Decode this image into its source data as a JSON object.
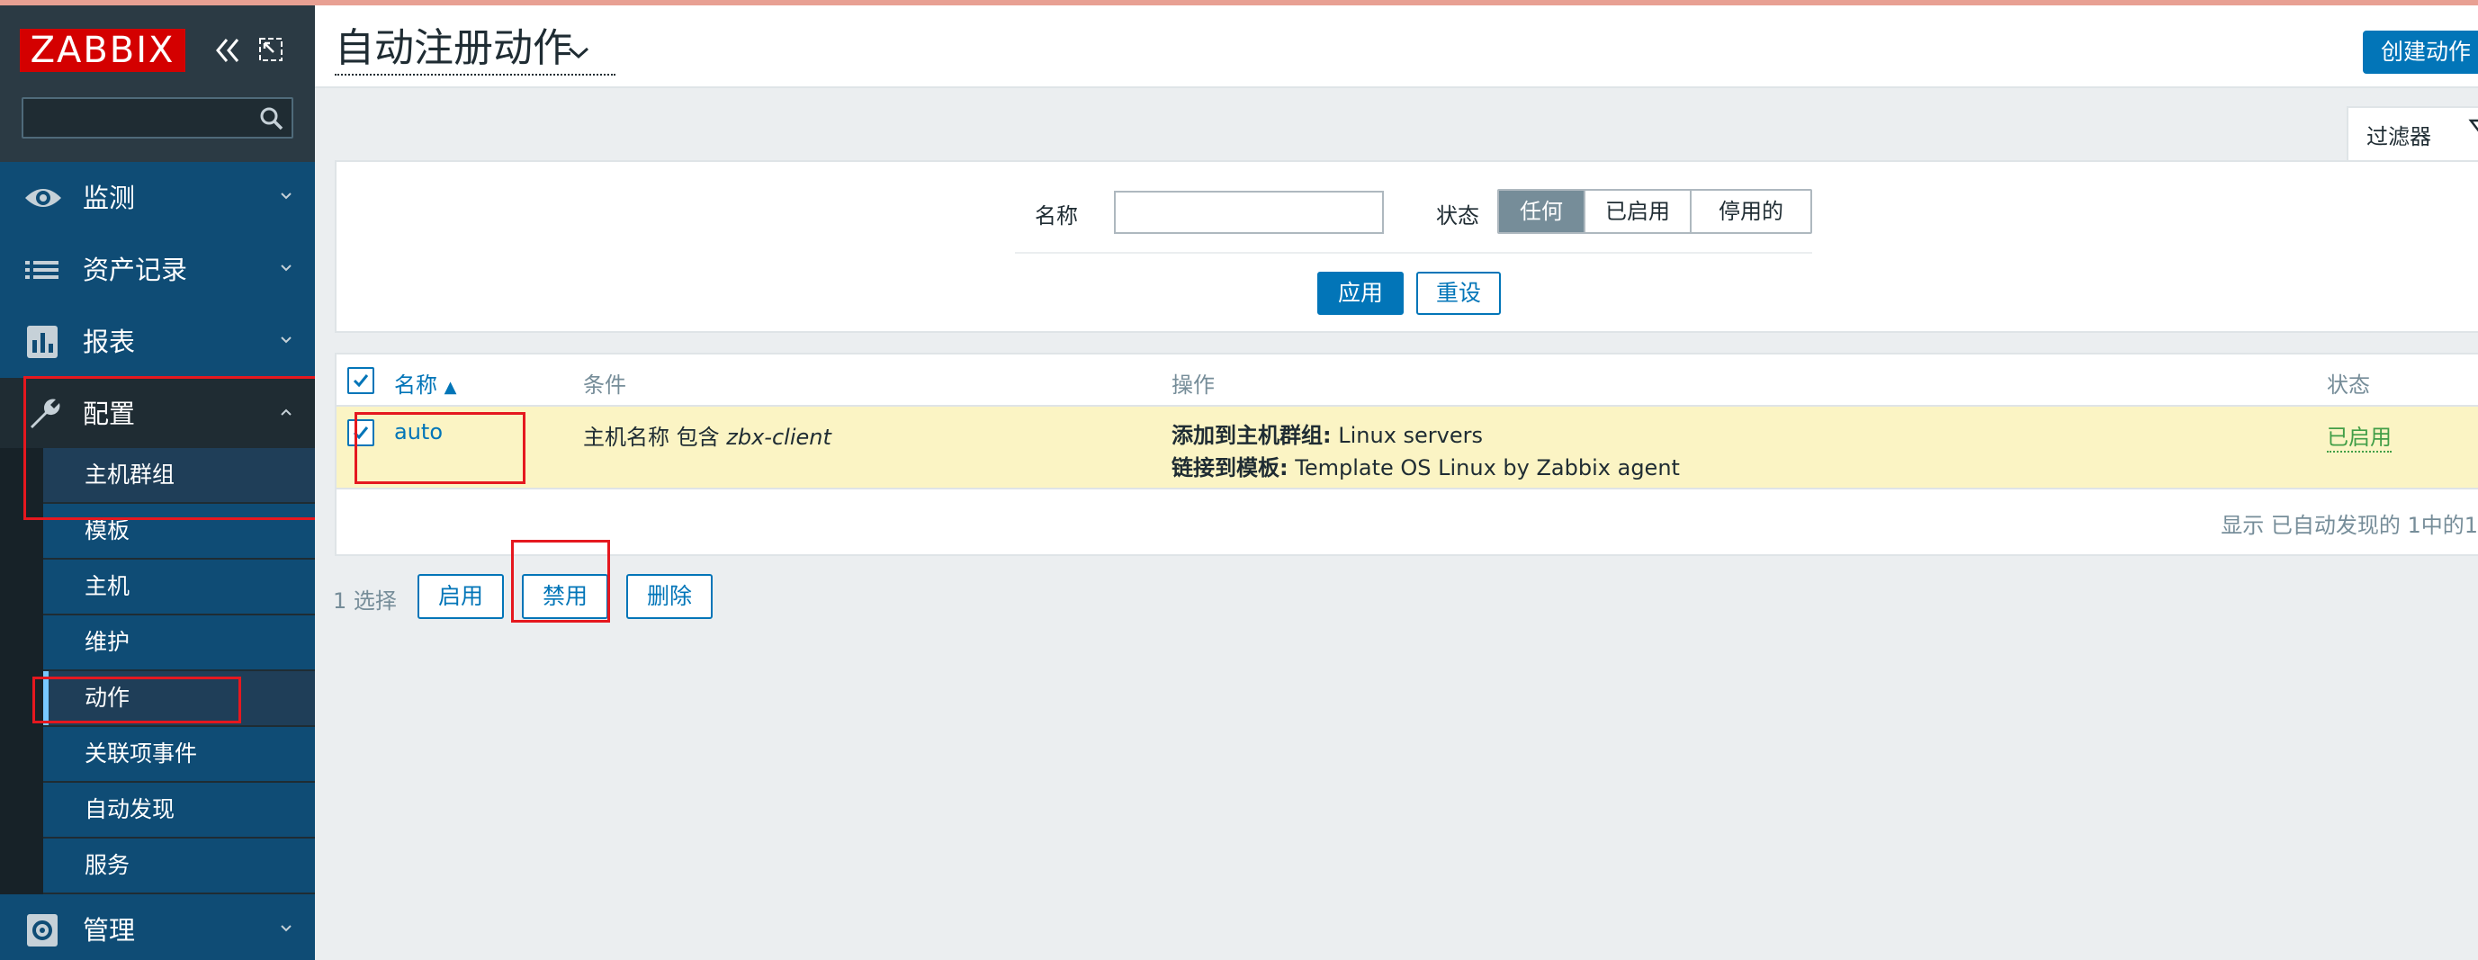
{
  "app": {
    "logo_text": "ZABBIX"
  },
  "sidebar": {
    "search_placeholder": "",
    "menu": [
      {
        "label": "监测",
        "icon": "eye-icon"
      },
      {
        "label": "资产记录",
        "icon": "list-icon"
      },
      {
        "label": "报表",
        "icon": "bar-chart-icon"
      },
      {
        "label": "配置",
        "icon": "wrench-icon"
      },
      {
        "label": "管理",
        "icon": "gear-icon"
      }
    ],
    "submenu": [
      {
        "label": "主机群组"
      },
      {
        "label": "模板"
      },
      {
        "label": "主机"
      },
      {
        "label": "维护"
      },
      {
        "label": "动作"
      },
      {
        "label": "关联项事件"
      },
      {
        "label": "自动发现"
      },
      {
        "label": "服务"
      }
    ]
  },
  "header": {
    "title": "自动注册动作",
    "create_button": "创建动作"
  },
  "filter": {
    "tab_label": "过滤器",
    "name_label": "名称",
    "name_value": "",
    "status_label": "状态",
    "status_options": [
      "任何",
      "已启用",
      "停用的"
    ],
    "status_selected": "任何",
    "apply_label": "应用",
    "reset_label": "重设"
  },
  "table": {
    "headers": {
      "name": "名称",
      "conditions": "条件",
      "operations": "操作",
      "status": "状态"
    },
    "rows": [
      {
        "name": "auto",
        "condition_prefix": "主机名称 包含 ",
        "condition_value": "zbx-client",
        "op1_label": "添加到主机群组:",
        "op1_value": " Linux servers",
        "op2_label": "链接到模板:",
        "op2_value": " Template OS Linux by Zabbix agent",
        "status": "已启用",
        "selected": true
      }
    ],
    "footer": "显示 已自动发现的 1中的1"
  },
  "actions": {
    "selected_count": "1 选择",
    "enable": "启用",
    "disable": "禁用",
    "delete": "删除"
  },
  "colors": {
    "sidebar_bg": "#0f4c75",
    "accent": "#0275b8",
    "logo_red": "#d40000",
    "selected_row": "#fbf4c4",
    "enabled_green": "#429e47",
    "annotation_red": "#e5181f"
  }
}
